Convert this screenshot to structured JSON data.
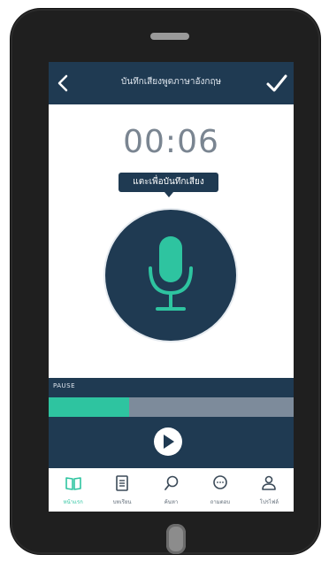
{
  "header": {
    "title": "บันทึกเสียงพูดภาษาอังกฤษ",
    "back_icon": "chevron-left-icon",
    "confirm_icon": "check-icon"
  },
  "recorder": {
    "timer": "00:06",
    "tooltip": "แตะเพื่อบันทึกเสียง",
    "mic_icon": "microphone-icon",
    "status_label": "PAUSE",
    "progress_fraction": 0.33,
    "play_icon": "play-icon"
  },
  "tabs": [
    {
      "label": "หน้าแรก",
      "icon": "book-icon",
      "active": true
    },
    {
      "label": "บทเรียน",
      "icon": "document-icon",
      "active": false
    },
    {
      "label": "ค้นหา",
      "icon": "search-icon",
      "active": false
    },
    {
      "label": "ถามตอบ",
      "icon": "chat-bubble-icon",
      "active": false
    },
    {
      "label": "โปรไฟล์",
      "icon": "user-icon",
      "active": false
    }
  ],
  "colors": {
    "primary": "#1f3a52",
    "accent": "#2ec4a0",
    "track": "#7d8b9b"
  }
}
